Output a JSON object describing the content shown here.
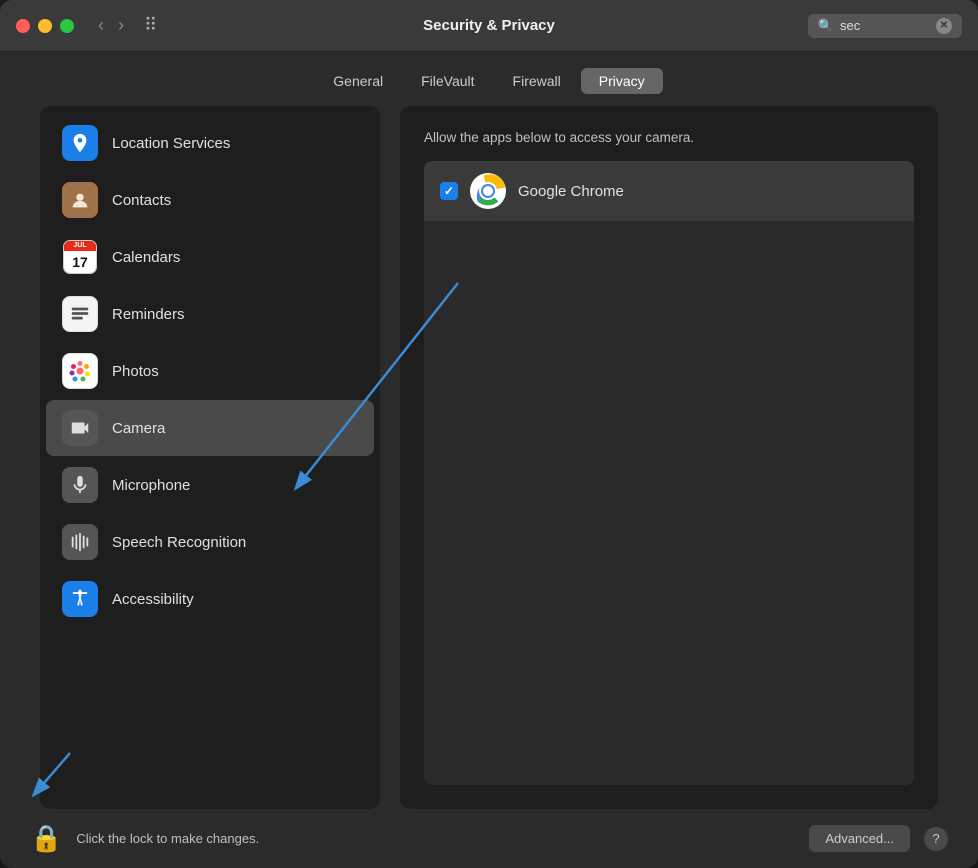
{
  "window": {
    "title": "Security & Privacy"
  },
  "titlebar": {
    "title": "Security & Privacy",
    "search_placeholder": "sec",
    "search_value": "sec",
    "controls": {
      "close": "close",
      "minimize": "minimize",
      "maximize": "maximize"
    }
  },
  "tabs": [
    {
      "label": "General",
      "active": false
    },
    {
      "label": "FileVault",
      "active": false
    },
    {
      "label": "Firewall",
      "active": false
    },
    {
      "label": "Privacy",
      "active": true
    }
  ],
  "sidebar": {
    "items": [
      {
        "id": "location-services",
        "label": "Location Services",
        "icon": "location"
      },
      {
        "id": "contacts",
        "label": "Contacts",
        "icon": "contacts"
      },
      {
        "id": "calendars",
        "label": "Calendars",
        "icon": "calendars"
      },
      {
        "id": "reminders",
        "label": "Reminders",
        "icon": "reminders"
      },
      {
        "id": "photos",
        "label": "Photos",
        "icon": "photos"
      },
      {
        "id": "camera",
        "label": "Camera",
        "icon": "camera",
        "active": true
      },
      {
        "id": "microphone",
        "label": "Microphone",
        "icon": "microphone"
      },
      {
        "id": "speech-recognition",
        "label": "Speech Recognition",
        "icon": "speech"
      },
      {
        "id": "accessibility",
        "label": "Accessibility",
        "icon": "accessibility"
      }
    ]
  },
  "main_panel": {
    "description": "Allow the apps below to access your camera.",
    "apps": [
      {
        "name": "Google Chrome",
        "checked": true
      }
    ]
  },
  "bottom_bar": {
    "lock_text": "Click the lock to make changes.",
    "advanced_label": "Advanced...",
    "help_label": "?"
  }
}
